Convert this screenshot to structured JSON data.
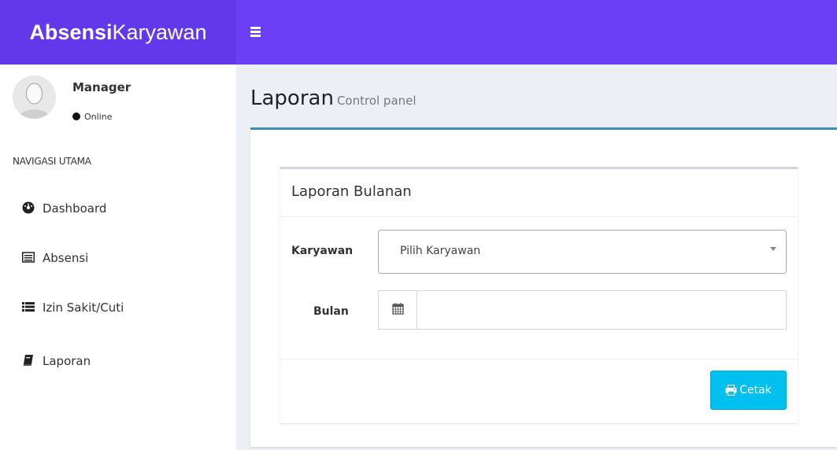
{
  "brand": {
    "bold": "Absensi",
    "regular": "Karyawan"
  },
  "user": {
    "name": "Manager",
    "status": "Online"
  },
  "sidebar": {
    "header": "NAVIGASI UTAMA",
    "items": [
      {
        "label": "Dashboard",
        "icon": "dashboard-icon"
      },
      {
        "label": "Absensi",
        "icon": "list-alt-icon"
      },
      {
        "label": "Izin Sakit/Cuti",
        "icon": "list-icon"
      },
      {
        "label": "Laporan",
        "icon": "book-icon"
      }
    ]
  },
  "page": {
    "title": "Laporan",
    "subtitle": "Control panel"
  },
  "report": {
    "title": "Laporan Bulanan",
    "karyawan_label": "Karyawan",
    "karyawan_placeholder": "Pilih Karyawan",
    "bulan_label": "Bulan",
    "bulan_value": "",
    "print_label": "Cetak"
  },
  "colors": {
    "header": "#6b3ff6",
    "brand": "#6238ea",
    "primary_border": "#3c8dbc",
    "button": "#00c0ef"
  }
}
